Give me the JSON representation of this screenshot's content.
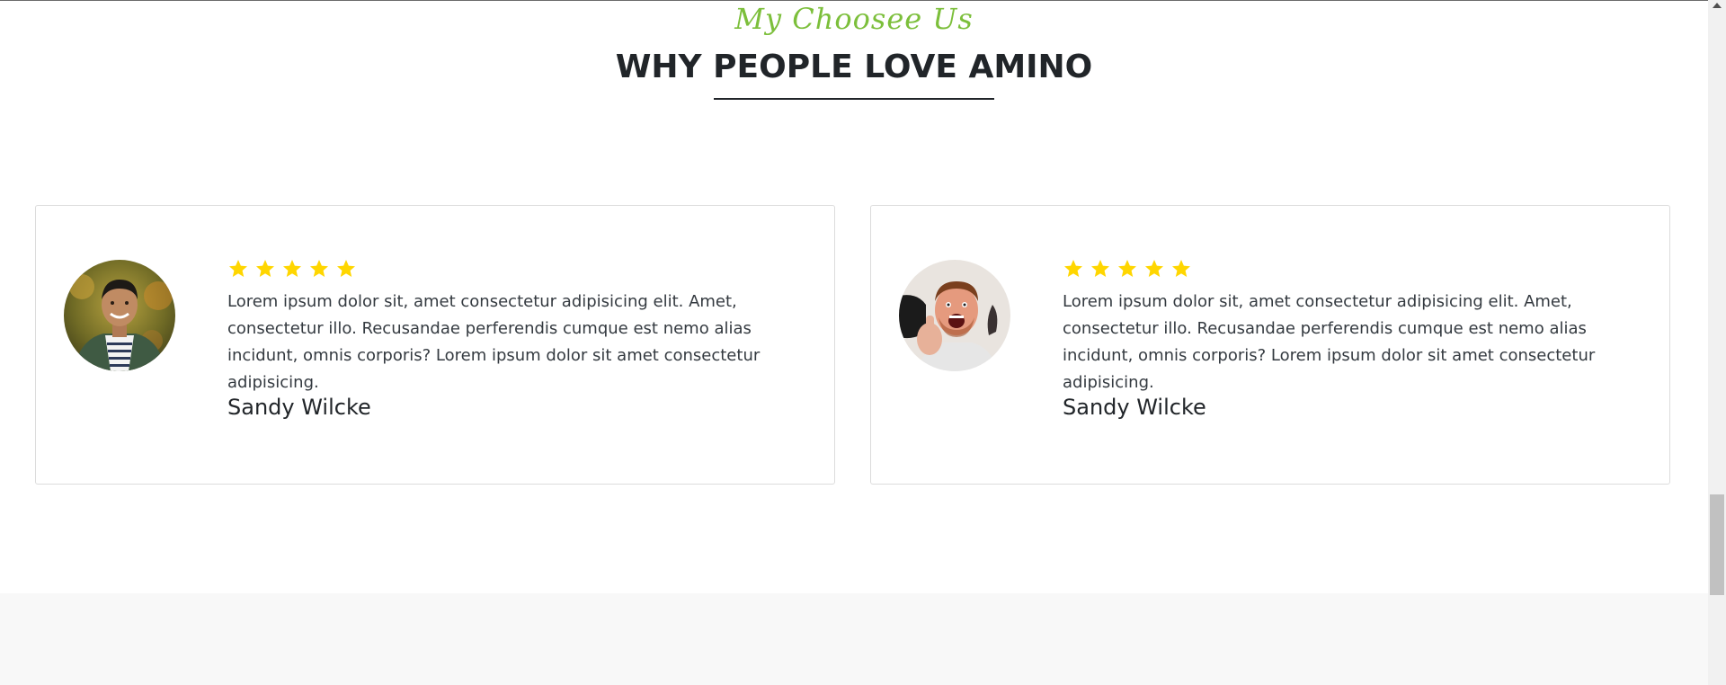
{
  "section": {
    "subtitle": "My Choosee Us",
    "title": "WHY PEOPLE LOVE AMINO"
  },
  "colors": {
    "accent_green": "#7cbf3b",
    "star_yellow": "#ffd600",
    "footer_band": "#f8f8f8"
  },
  "testimonials": [
    {
      "avatar_icon": "smiling-man-portrait",
      "rating": 5,
      "text": "Lorem ipsum dolor sit, amet consectetur adipisicing elit. Amet, consectetur illo. Recusandae perferendis cumque est nemo alias incidunt, omnis corporis? Lorem ipsum dolor sit amet consectetur adipisicing.",
      "name": "Sandy Wilcke"
    },
    {
      "avatar_icon": "excited-man-thumbs-up-portrait",
      "rating": 5,
      "text": "Lorem ipsum dolor sit, amet consectetur adipisicing elit. Amet, consectetur illo. Recusandae perferendis cumque est nemo alias incidunt, omnis corporis? Lorem ipsum dolor sit amet consectetur adipisicing.",
      "name": "Sandy Wilcke"
    }
  ]
}
